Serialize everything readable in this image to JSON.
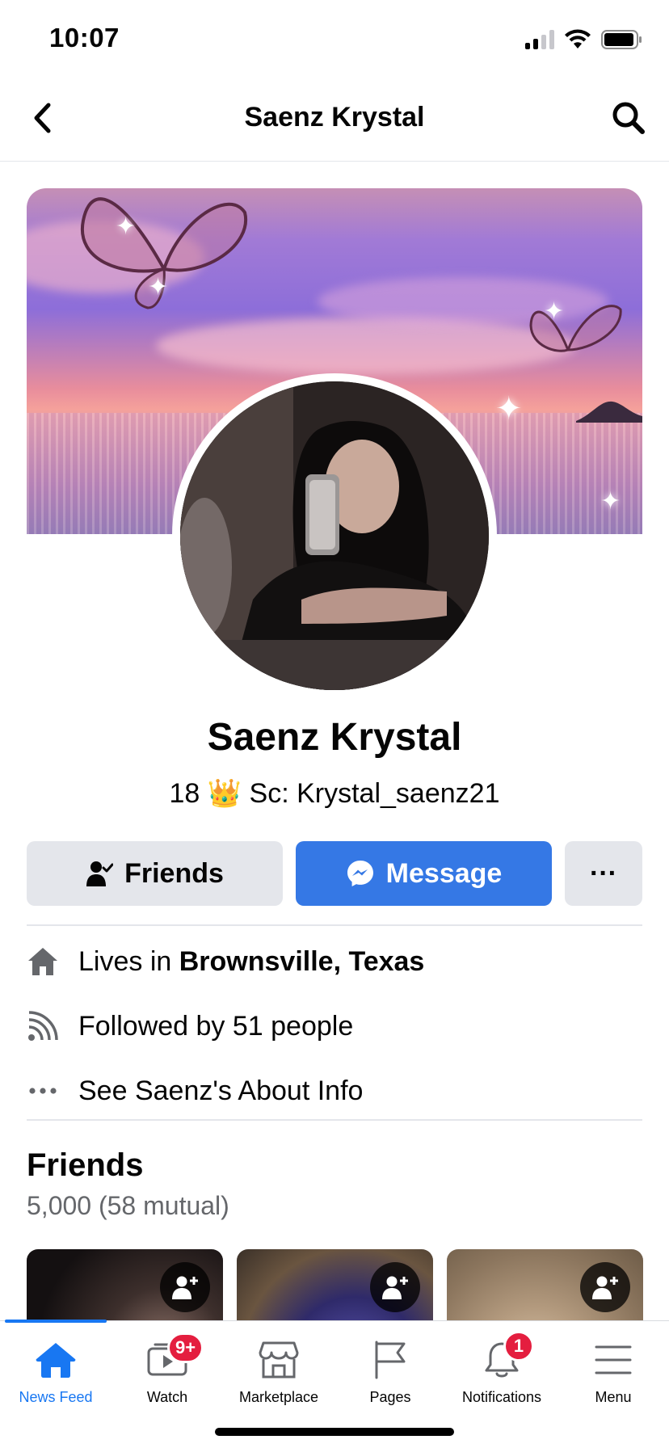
{
  "status_bar": {
    "time": "10:07"
  },
  "nav": {
    "title": "Saenz Krystal"
  },
  "profile": {
    "name": "Saenz Krystal",
    "bio": "18 👑  Sc: Krystal_saenz21"
  },
  "actions": {
    "friends_label": "Friends",
    "message_label": "Message",
    "more_label": "···"
  },
  "info": {
    "lives_prefix": "Lives in ",
    "lives_place": "Brownsville, Texas",
    "followed": "Followed by 51 people",
    "about": "See Saenz's About Info"
  },
  "friends": {
    "title": "Friends",
    "count": "5,000 (58 mutual)"
  },
  "tabbar": {
    "tabs": [
      {
        "label": "News Feed",
        "icon": "home-icon",
        "active": true
      },
      {
        "label": "Watch",
        "icon": "watch-icon",
        "badge": "9+"
      },
      {
        "label": "Marketplace",
        "icon": "marketplace-icon"
      },
      {
        "label": "Pages",
        "icon": "pages-flag-icon"
      },
      {
        "label": "Notifications",
        "icon": "bell-icon",
        "badge": "1"
      },
      {
        "label": "Menu",
        "icon": "menu-icon"
      }
    ]
  },
  "colors": {
    "accent": "#1877f2",
    "message_button": "#3578e5",
    "badge": "#e41e3f",
    "secondary_button": "#e4e6eb"
  }
}
